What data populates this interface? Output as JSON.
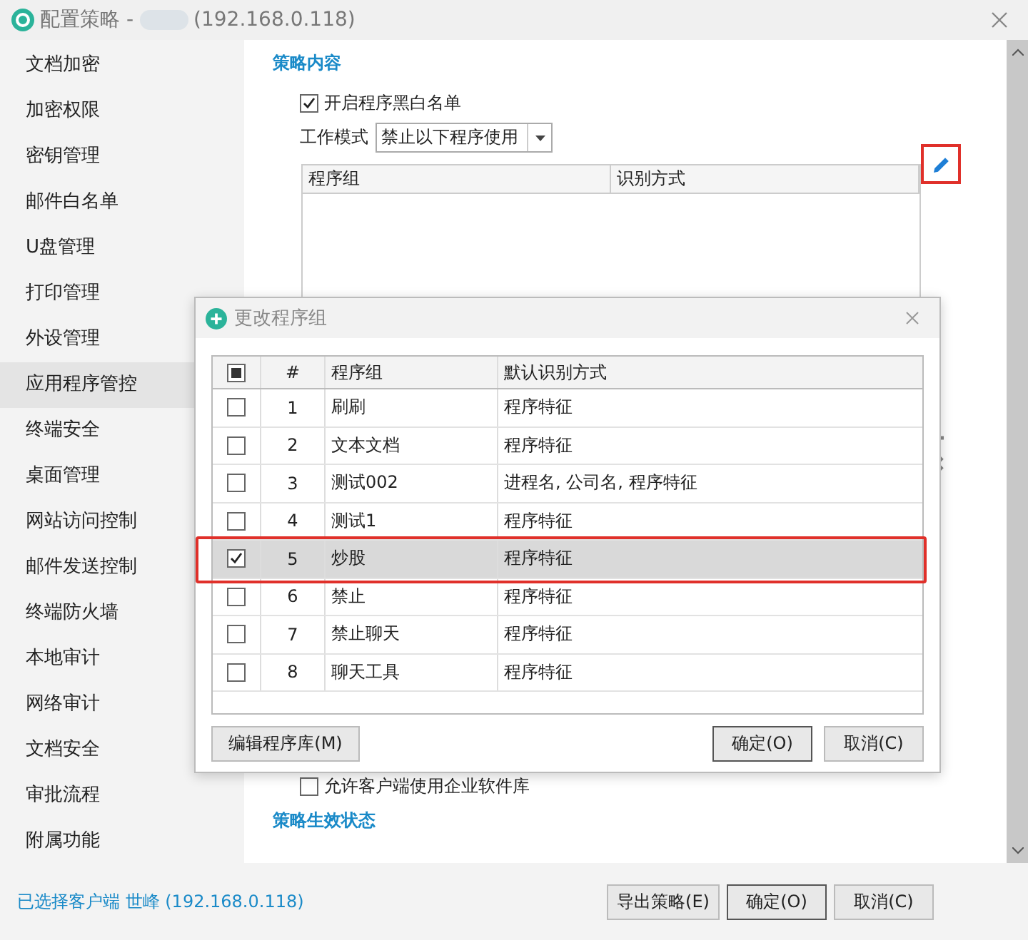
{
  "window": {
    "title": "配置策略 -",
    "title_address": "(192.168.0.118)"
  },
  "sidebar": {
    "items": [
      {
        "label": "文档加密",
        "selected": false
      },
      {
        "label": "加密权限",
        "selected": false
      },
      {
        "label": "密钥管理",
        "selected": false
      },
      {
        "label": "邮件白名单",
        "selected": false
      },
      {
        "label": "U盘管理",
        "selected": false
      },
      {
        "label": "打印管理",
        "selected": false
      },
      {
        "label": "外设管理",
        "selected": false
      },
      {
        "label": "应用程序管控",
        "selected": true
      },
      {
        "label": "终端安全",
        "selected": false
      },
      {
        "label": "桌面管理",
        "selected": false
      },
      {
        "label": "网站访问控制",
        "selected": false
      },
      {
        "label": "邮件发送控制",
        "selected": false
      },
      {
        "label": "终端防火墙",
        "selected": false
      },
      {
        "label": "本地审计",
        "selected": false
      },
      {
        "label": "网络审计",
        "selected": false
      },
      {
        "label": "文档安全",
        "selected": false
      },
      {
        "label": "审批流程",
        "selected": false
      },
      {
        "label": "附属功能",
        "selected": false
      }
    ]
  },
  "content": {
    "section_title": "策略内容",
    "enable_list": {
      "label": "开启程序黑白名单",
      "checked": true
    },
    "work_mode": {
      "label": "工作模式",
      "value": "禁止以下程序使用"
    },
    "table": {
      "columns": [
        "程序组",
        "识别方式"
      ]
    },
    "allow_library": {
      "label": "允许客户端使用企业软件库",
      "checked": false
    },
    "status_section_title": "策略生效状态"
  },
  "dialog": {
    "title": "更改程序组",
    "columns": [
      "#",
      "程序组",
      "默认识别方式"
    ],
    "select_all_partial": true,
    "rows": [
      {
        "number": "1",
        "group": "刷刷",
        "method": "程序特征",
        "selected": false
      },
      {
        "number": "2",
        "group": "文本文档",
        "method": "程序特征",
        "selected": false
      },
      {
        "number": "3",
        "group": "测试002",
        "method": "进程名, 公司名, 程序特征",
        "selected": false
      },
      {
        "number": "4",
        "group": "测试1",
        "method": "程序特征",
        "selected": false
      },
      {
        "number": "5",
        "group": "炒股",
        "method": "程序特征",
        "selected": true
      },
      {
        "number": "6",
        "group": "禁止",
        "method": "程序特征",
        "selected": false
      },
      {
        "number": "7",
        "group": "禁止聊天",
        "method": "程序特征",
        "selected": false
      },
      {
        "number": "8",
        "group": "聊天工具",
        "method": "程序特征",
        "selected": false
      }
    ],
    "buttons": [
      {
        "label": "编辑程序库(M)",
        "kind": "left"
      },
      {
        "label": "确定(O)",
        "kind": "default"
      },
      {
        "label": "取消(C)",
        "kind": "normal"
      }
    ]
  },
  "status_bar": {
    "client": "已选择客户端 世峰 (192.168.0.118)",
    "buttons": [
      {
        "label": "导出策略(E)",
        "kind": "normal"
      },
      {
        "label": "确定(O)",
        "kind": "default"
      },
      {
        "label": "取消(C)",
        "kind": "normal"
      }
    ]
  }
}
